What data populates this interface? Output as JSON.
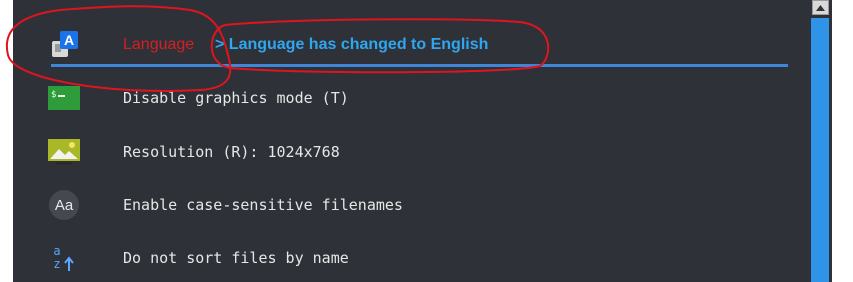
{
  "menu": {
    "items": [
      {
        "label": "Language",
        "message": "> Language has changed to English",
        "icon": "language-icon"
      },
      {
        "label": "Disable graphics mode (T)",
        "icon": "terminal-icon"
      },
      {
        "label": "Resolution (R): 1024x768",
        "icon": "image-icon"
      },
      {
        "label": "Enable case-sensitive filenames",
        "icon": "font-case-icon",
        "icon_text": "Aa"
      },
      {
        "label": "Do not sort files by name",
        "icon": "sort-icon",
        "icon_text_top": "a",
        "icon_text_bottom": "z"
      }
    ]
  },
  "colors": {
    "background": "#2e3238",
    "language_label": "#d42020",
    "language_message": "#2fa6f0",
    "underline": "#3f86d6",
    "scroll_thumb": "#2f93e8",
    "annotation": "#e0141e"
  }
}
